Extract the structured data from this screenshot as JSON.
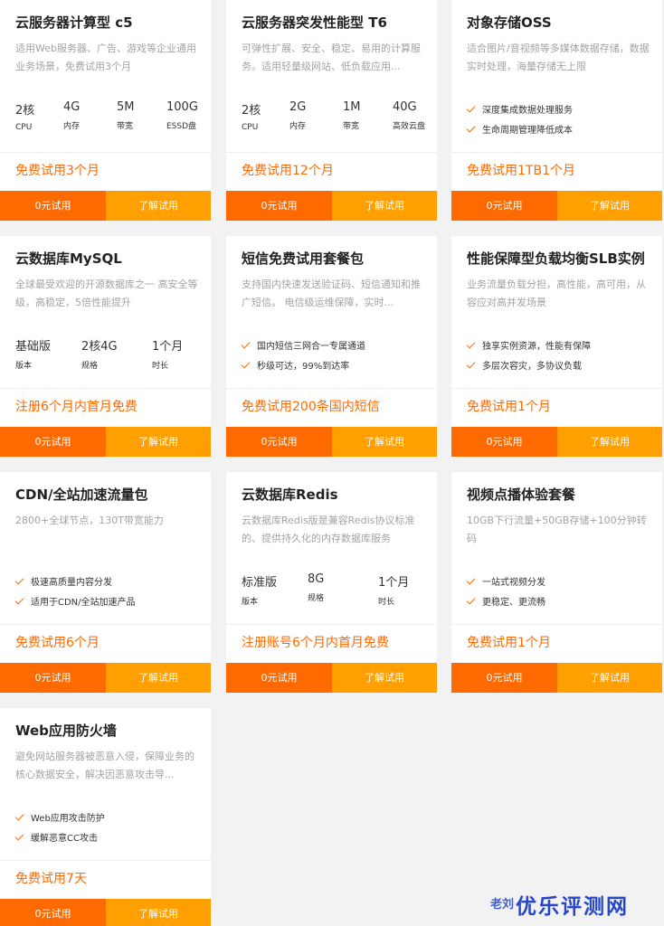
{
  "products": [
    {
      "title": "云服务器计算型 c5",
      "desc": "适用Web服务器、广告、游戏等企业通用业务场景，免费试用3个月",
      "specs": [
        {
          "value": "2核",
          "label": "CPU"
        },
        {
          "value": "4G",
          "label": "内存"
        },
        {
          "value": "5M",
          "label": "带宽"
        },
        {
          "value": "100G",
          "label": "ESSD盘"
        }
      ],
      "features": [],
      "offer": "免费试用3个月",
      "btn_trial": "0元试用",
      "btn_more": "了解试用"
    },
    {
      "title": "云服务器突发性能型 T6",
      "desc": "可弹性扩展、安全、稳定、易用的计算服务。适用轻量级网站、低负载应用...",
      "specs": [
        {
          "value": "2核",
          "label": "CPU"
        },
        {
          "value": "2G",
          "label": "内存"
        },
        {
          "value": "1M",
          "label": "带宽"
        },
        {
          "value": "40G",
          "label": "高效云盘"
        }
      ],
      "features": [],
      "offer": "免费试用12个月",
      "btn_trial": "0元试用",
      "btn_more": "了解试用"
    },
    {
      "title": "对象存储OSS",
      "desc": "适合图片/音视频等多媒体数据存储，数据实时处理，海量存储无上限",
      "specs": [],
      "features": [
        "深度集成数据处理服务",
        "生命周期管理降低成本"
      ],
      "offer": "免费试用1TB1个月",
      "btn_trial": "0元试用",
      "btn_more": "了解试用"
    },
    {
      "title": "云数据库MySQL",
      "desc": "全球最受欢迎的开源数据库之一 高安全等级，高稳定，5倍性能提升",
      "specs": [
        {
          "value": "基础版",
          "label": "版本"
        },
        {
          "value": "2核4G",
          "label": "规格"
        },
        {
          "value": "1个月",
          "label": "时长"
        }
      ],
      "features": [],
      "offer": "注册6个月内首月免费",
      "btn_trial": "0元试用",
      "btn_more": "了解试用"
    },
    {
      "title": "短信免费试用套餐包",
      "desc": "支持国内快速发送验证码、短信通知和推广短信。 电信级运维保障，实时...",
      "specs": [],
      "features": [
        "国内短信三网合一专属通道",
        "秒级可达，99%到达率"
      ],
      "offer": "免费试用200条国内短信",
      "btn_trial": "0元试用",
      "btn_more": "了解试用"
    },
    {
      "title": "性能保障型负载均衡SLB实例",
      "desc": "业务流量负载分担，高性能，高可用，从容应对高并发场景",
      "specs": [],
      "features": [
        "独享实例资源，性能有保障",
        "多层次容灾，多协议负载"
      ],
      "offer": "免费试用1个月",
      "btn_trial": "0元试用",
      "btn_more": "了解试用"
    },
    {
      "title": "CDN/全站加速流量包",
      "desc": "2800+全球节点，130T带宽能力",
      "specs": [],
      "features": [
        "极速高质量内容分发",
        "适用于CDN/全站加速产品"
      ],
      "offer": "免费试用6个月",
      "btn_trial": "0元试用",
      "btn_more": "了解试用"
    },
    {
      "title": "云数据库Redis",
      "desc": "云数据库Redis版是兼容Redis协议标准的、提供持久化的内存数据库服务",
      "specs": [
        {
          "value": "标准版",
          "label": "版本"
        },
        {
          "value": "8G",
          "label": "规格"
        },
        {
          "value": "1个月",
          "label": "时长"
        }
      ],
      "features": [],
      "offer": "注册账号6个月内首月免费",
      "btn_trial": "0元试用",
      "btn_more": "了解试用"
    },
    {
      "title": "视频点播体验套餐",
      "desc": "10GB下行流量+50GB存储+100分钟转码",
      "specs": [],
      "features": [
        "一站式视频分发",
        "更稳定、更流畅"
      ],
      "offer": "免费试用1个月",
      "btn_trial": "0元试用",
      "btn_more": "了解试用"
    },
    {
      "title": "Web应用防火墙",
      "desc": "避免网站服务器被恶意入侵，保障业务的核心数据安全，解决因恶意攻击导...",
      "specs": [],
      "features": [
        "Web应用攻击防护",
        "缓解恶意CC攻击"
      ],
      "offer": "免费试用7天",
      "btn_trial": "0元试用",
      "btn_more": "了解试用"
    }
  ],
  "watermark": {
    "small": "老刘",
    "big": "优乐评测网"
  }
}
